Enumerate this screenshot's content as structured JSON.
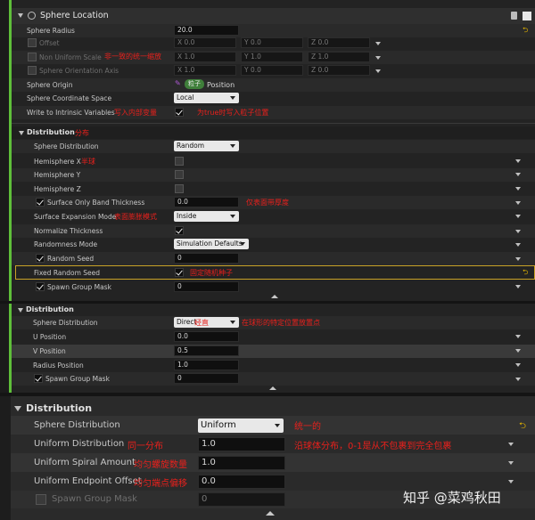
{
  "module": {
    "title": "Sphere Location",
    "rows": {
      "radius": {
        "label": "Sphere Radius",
        "value": "20.0"
      },
      "offset": {
        "label": "Offset",
        "x": "X 0.0",
        "y": "Y 0.0",
        "z": "Z 0.0"
      },
      "non_uniform": {
        "label": "Non Uniform Scale",
        "x": "X 1.0",
        "y": "Y 1.0",
        "z": "Z 1.0",
        "note": "非一致的统一缩放"
      },
      "orientation": {
        "label": "Sphere Orientation Axis",
        "x": "X 1.0",
        "y": "Y 0.0",
        "z": "Z 0.0"
      },
      "origin": {
        "label": "Sphere Origin",
        "pill": "粒子",
        "value": "Position"
      },
      "coord_space": {
        "label": "Sphere Coordinate Space",
        "value": "Local"
      },
      "intrinsic": {
        "label": "Write to Intrinsic Variables",
        "note": "写入内部变量",
        "note2": "为true时写入粒子位置"
      }
    }
  },
  "distribution1": {
    "title": "Distribution",
    "note": "分布",
    "sphere_dist": {
      "label": "Sphere Distribution",
      "value": "Random"
    },
    "hemi_x": {
      "label": "Hemisphere X",
      "note": "半球"
    },
    "hemi_y": {
      "label": "Hemisphere Y"
    },
    "hemi_z": {
      "label": "Hemisphere Z"
    },
    "surface_band": {
      "label": "Surface Only Band Thickness",
      "value": "0.0",
      "note": "仅表面带厚度"
    },
    "surface_exp": {
      "label": "Surface Expansion Mode",
      "value": "Inside",
      "note": "表面膨胀模式"
    },
    "normalize": {
      "label": "Normalize Thickness"
    },
    "randomness": {
      "label": "Randomness Mode",
      "value": "Simulation Defaults"
    },
    "random_seed": {
      "label": "Random Seed",
      "value": "0"
    },
    "fixed_seed": {
      "label": "Fixed Random Seed",
      "note": "固定随机种子"
    },
    "spawn_mask": {
      "label": "Spawn Group Mask",
      "value": "0"
    }
  },
  "distribution2": {
    "title": "Distribution",
    "sphere_dist": {
      "label": "Sphere Distribution",
      "value": "Direct",
      "note": "经直",
      "note2": "在球形的特定位置放置点"
    },
    "u_pos": {
      "label": "U Position",
      "value": "0.0"
    },
    "v_pos": {
      "label": "V Position",
      "value": "0.5"
    },
    "radius_pos": {
      "label": "Radius Position",
      "value": "1.0"
    },
    "spawn_mask": {
      "label": "Spawn Group Mask",
      "value": "0"
    }
  },
  "distribution3": {
    "title": "Distribution",
    "sphere_dist": {
      "label": "Sphere Distribution",
      "value": "Uniform",
      "note": "统一的"
    },
    "uniform_dist": {
      "label": "Uniform Distribution",
      "value": "1.0",
      "note": "同一分布",
      "note2": "沿球体分布，0-1是从不包裹到完全包裹"
    },
    "spiral": {
      "label": "Uniform Spiral Amount",
      "value": "1.0",
      "note": "均匀螺旋数量"
    },
    "endpoint": {
      "label": "Uniform Endpoint Offset",
      "value": "0.0",
      "note": "均匀端点偏移"
    },
    "spawn_mask": {
      "label": "Spawn Group Mask",
      "value": "0"
    }
  },
  "watermark": "知乎 @菜鸡秋田"
}
